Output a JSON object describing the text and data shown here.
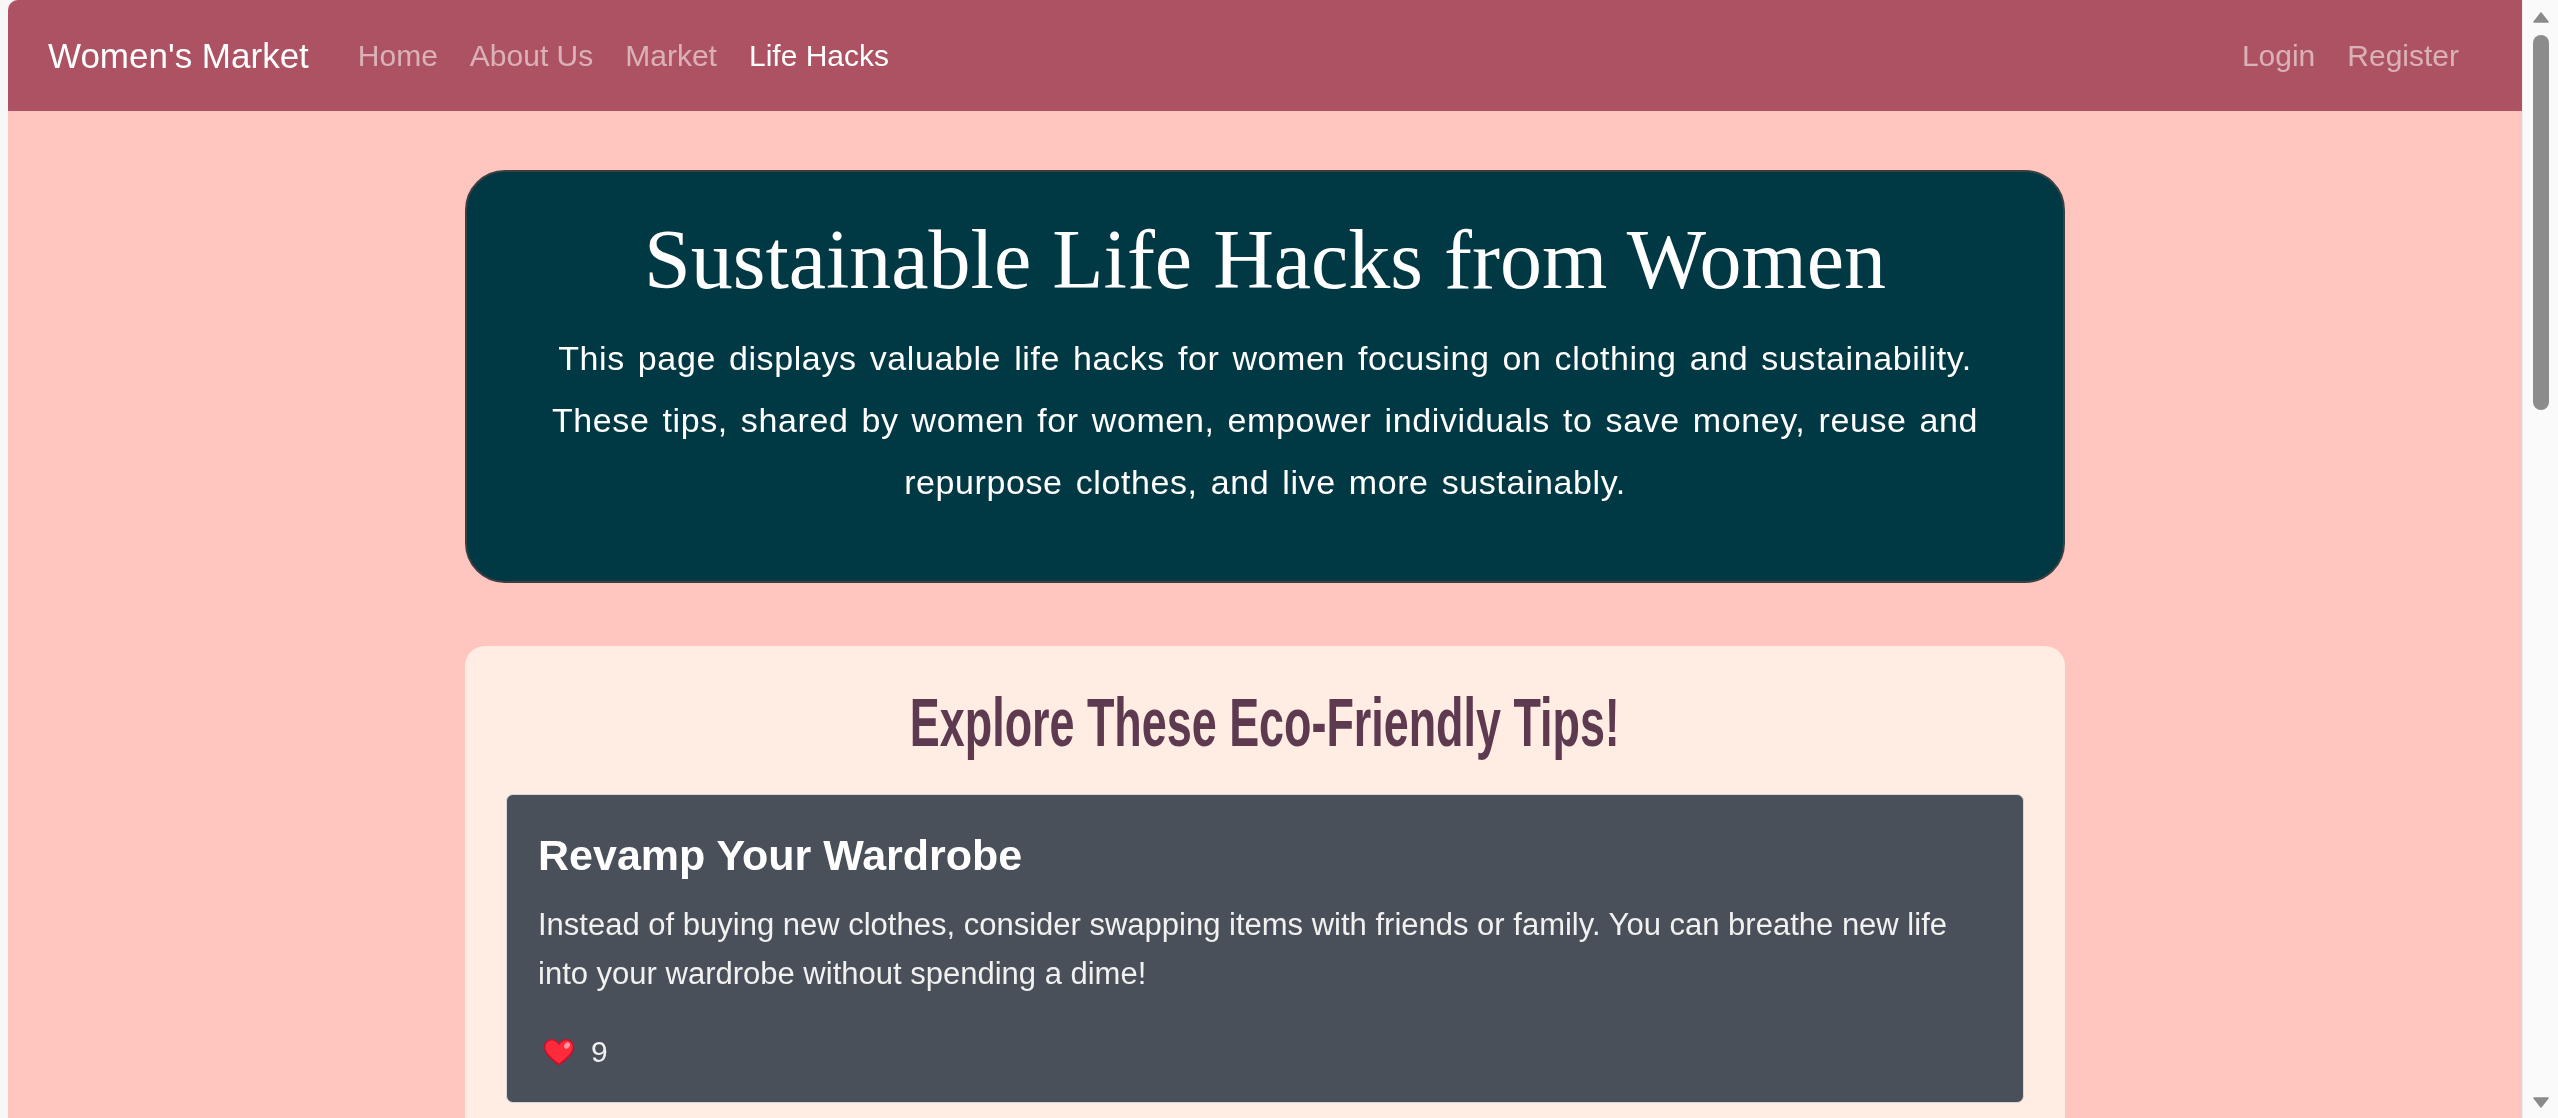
{
  "navbar": {
    "brand": "Women's Market",
    "links": [
      {
        "label": "Home",
        "selected": false
      },
      {
        "label": "About Us",
        "selected": false
      },
      {
        "label": "Market",
        "selected": false
      },
      {
        "label": "Life Hacks",
        "selected": true
      }
    ],
    "account_links": [
      {
        "label": "Login",
        "selected": false
      },
      {
        "label": "Register",
        "selected": false
      }
    ]
  },
  "hero": {
    "title": "Sustainable Life Hacks from Women",
    "text": "This page displays valuable life hacks for women focusing on clothing and sustainability. These tips, shared by women for women, empower individuals to save money, reuse and repurpose clothes, and live more sustainably."
  },
  "tips_section": {
    "heading": "Explore These Eco-Friendly Tips!",
    "tips": [
      {
        "title": "Revamp Your Wardrobe",
        "text": "Instead of buying new clothes, consider swapping items with friends or family. You can breathe new life into your wardrobe without spending a dime!",
        "likes": "9"
      }
    ]
  }
}
